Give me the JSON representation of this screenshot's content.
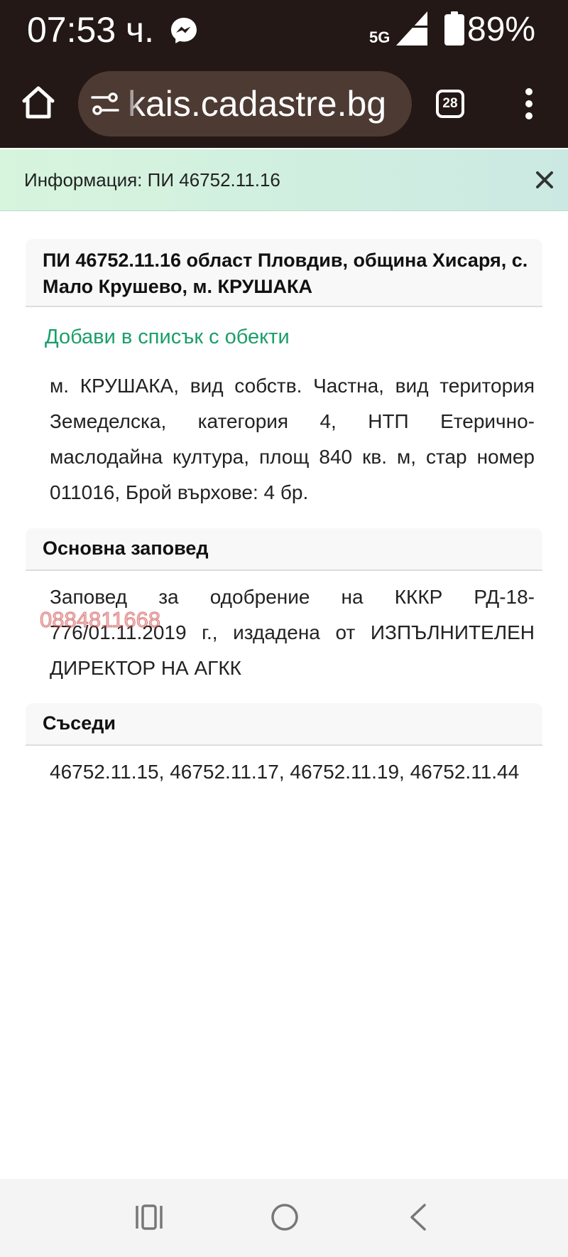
{
  "status_bar": {
    "time": "07:53 ч.",
    "network": "5G",
    "battery": "89%",
    "icons": [
      "messenger-icon",
      "signal-icon",
      "battery-icon"
    ]
  },
  "browser": {
    "url": "kais.cadastre.bg",
    "tab_count": "28",
    "icons": [
      "home-icon",
      "site-settings-icon",
      "more-vert-icon"
    ]
  },
  "info_bar": {
    "text": "Информация: ПИ 46752.11.16",
    "close_icon": "close-icon"
  },
  "parcel": {
    "title": "ПИ 46752.11.16 област Пловдив, община Хисаря, с. Мало Крушево, м. КРУШАКА",
    "add_link": "Добави в списък с обекти",
    "description": "м. КРУШАКА, вид собств. Частна, вид територия Земеделска, категория 4, НТП Етерично-маслодайна култура, площ 840 кв. м, стар номер 011016, Брой върхове: 4 бр."
  },
  "order": {
    "heading": "Основна заповед",
    "text": "Заповед за одобрение на КККР РД-18-776/01.11.2019 г., издадена от ИЗПЪЛНИТЕЛЕН ДИРЕКТОР НА АГКК"
  },
  "neighbours": {
    "heading": "Съседи",
    "text": "46752.11.15, 46752.11.17, 46752.11.19, 46752.11.44"
  },
  "watermark": "0884811668",
  "nav_bar": {
    "icons": [
      "recents-icon",
      "home-circle-icon",
      "back-icon"
    ]
  },
  "colors": {
    "topbar": "#231815",
    "url_pill": "#4d3a33",
    "info_bar": "#d7f5dd",
    "link": "#1b9e6b",
    "watermark": "#d65555"
  }
}
